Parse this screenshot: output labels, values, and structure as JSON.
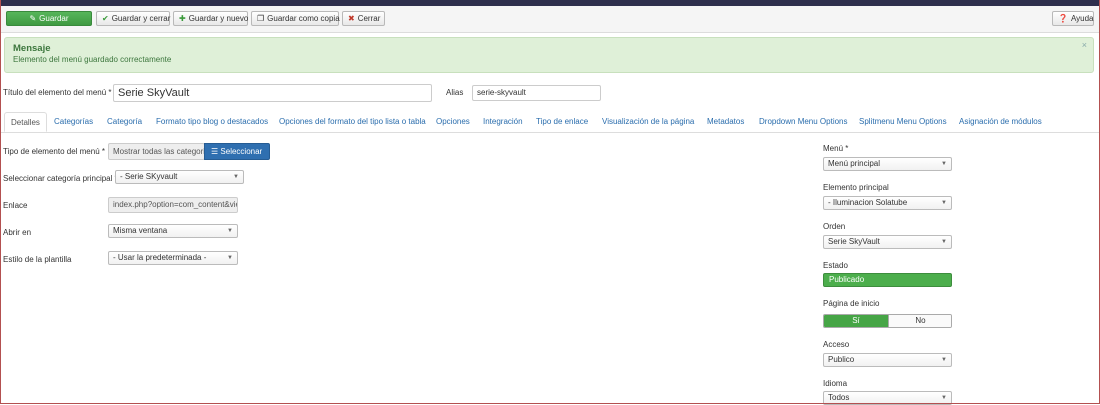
{
  "toolbar": {
    "save": "Guardar",
    "save_close": "Guardar y cerrar",
    "save_new": "Guardar y nuevo",
    "save_copy": "Guardar como copia",
    "close": "Cerrar",
    "help": "Ayuda"
  },
  "alert": {
    "heading": "Mensaje",
    "message": "Elemento del menú guardado correctamente",
    "close": "×"
  },
  "title_row": {
    "title_label": "Título del elemento del menú *",
    "title_value": "Serie SkyVault",
    "alias_label": "Alias",
    "alias_value": "serie-skyvault"
  },
  "tabs": [
    "Detalles",
    "Categorías",
    "Categoría",
    "Formato tipo blog o destacados",
    "Opciones del formato del tipo lista o tabla",
    "Opciones",
    "Integración",
    "Tipo de enlace",
    "Visualización de la página",
    "Metadatos",
    "Dropdown Menu Options",
    "Splitmenu Menu Options",
    "Asignación de módulos"
  ],
  "details": {
    "type_label": "Tipo de elemento del menú *",
    "type_value": "Mostrar todas las categori",
    "select_button": "Seleccionar",
    "parent_cat_label": "Seleccionar categoría principal *",
    "parent_cat_value": "- Serie SKyvault",
    "link_label": "Enlace",
    "link_value": "index.php?option=com_content&vie",
    "open_in_label": "Abrir en",
    "open_in_value": "Misma ventana",
    "template_label": "Estilo de la plantilla",
    "template_value": "- Usar la predeterminada -"
  },
  "side": {
    "menu_label": "Menú *",
    "menu_value": "Menú principal",
    "parent_label": "Elemento principal",
    "parent_value": "- Iluminacion Solatube",
    "order_label": "Orden",
    "order_value": "Serie SkyVault",
    "status_label": "Estado",
    "status_value": "Publicado",
    "home_label": "Página de inicio",
    "home_yes": "Sí",
    "home_no": "No",
    "access_label": "Acceso",
    "access_value": "Publico",
    "language_label": "Idioma",
    "language_value": "Todos"
  },
  "colors": {
    "primary": "#2f6fb0",
    "success": "#46a546",
    "alert_bg": "#dff0d8",
    "header": "#2e2f4d"
  },
  "icons": {
    "save": "edit-icon",
    "save_close": "check-icon",
    "save_new": "plus-icon",
    "save_copy": "copy-icon",
    "close": "close-circle-icon",
    "help": "question-icon",
    "select": "list-icon",
    "dropdown": "caret-down-icon"
  }
}
